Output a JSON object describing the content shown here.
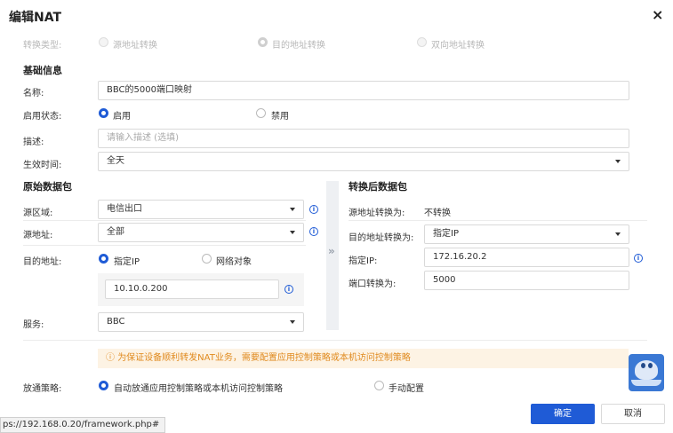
{
  "dialog": {
    "title": "编辑NAT",
    "close_glyph": "×"
  },
  "conversion_type": {
    "label": "转换类型:",
    "options": [
      {
        "label": "源地址转换",
        "selected": false
      },
      {
        "label": "目的地址转换",
        "selected": true
      },
      {
        "label": "双向地址转换",
        "selected": false
      }
    ]
  },
  "basic": {
    "section_title": "基础信息",
    "name_label": "名称:",
    "name_value": "BBC的5000端口映射",
    "status_label": "启用状态:",
    "status_options": [
      {
        "label": "启用",
        "selected": true
      },
      {
        "label": "禁用",
        "selected": false
      }
    ],
    "desc_label": "描述:",
    "desc_placeholder": "请输入描述 (选填)",
    "time_label": "生效时间:",
    "time_value": "全天"
  },
  "original": {
    "section_title": "原始数据包",
    "src_zone_label": "源区域:",
    "src_zone_value": "电信出口",
    "src_addr_label": "源地址:",
    "src_addr_value": "全部",
    "dst_addr_label": "目的地址:",
    "dst_addr_options": [
      {
        "label": "指定IP",
        "selected": true
      },
      {
        "label": "网络对象",
        "selected": false
      }
    ],
    "dst_ip_value": "10.10.0.200",
    "service_label": "服务:",
    "service_value": "BBC"
  },
  "translated": {
    "section_title": "转换后数据包",
    "src_conv_label": "源地址转换为:",
    "src_conv_value": "不转换",
    "dst_conv_label": "目的地址转换为:",
    "dst_conv_value": "指定IP",
    "ip_label": "指定IP:",
    "ip_value": "172.16.20.2",
    "port_label": "端口转换为:",
    "port_value": "5000"
  },
  "warning": {
    "icon": "ⓘ",
    "text": "为保证设备顺利转发NAT业务，需要配置应用控制策略或本机访问控制策略"
  },
  "policy": {
    "label": "放通策略:",
    "options": [
      {
        "label": "自动放通应用控制策略或本机访问控制策略",
        "selected": true
      },
      {
        "label": "手动配置",
        "selected": false
      }
    ]
  },
  "buttons": {
    "ok": "确定",
    "cancel": "取消"
  },
  "status_bar": {
    "url": "ps://192.168.0.20/framework.php#"
  },
  "colors": {
    "primary": "#1f5bd6",
    "warning_text": "#e08a1e",
    "warning_bg": "#fdf3e4"
  }
}
